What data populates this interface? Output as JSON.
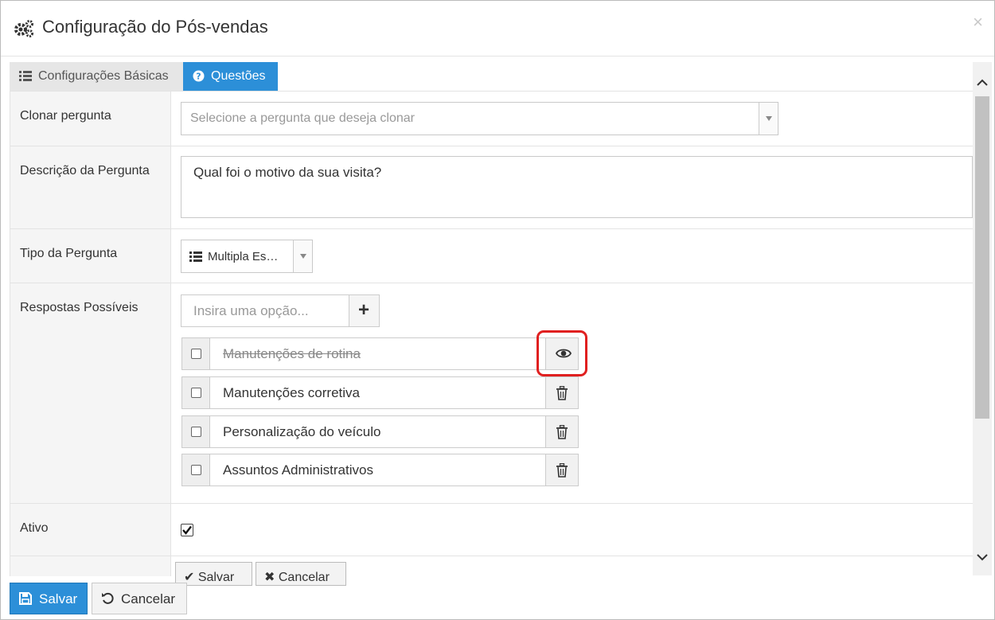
{
  "dialog": {
    "title": "Configuração do Pós-vendas",
    "close_symbol": "×",
    "header_icon": "gears-icon"
  },
  "tabs": [
    {
      "label": "Configurações Básicas",
      "icon": "list-icon",
      "active": false
    },
    {
      "label": "Questões",
      "icon": "question-circle-icon",
      "active": true
    }
  ],
  "form": {
    "clone": {
      "label": "Clonar pergunta",
      "placeholder": "Selecione a pergunta que deseja clonar"
    },
    "description": {
      "label": "Descrição da Pergunta",
      "value": "Qual foi o motivo da sua visita?"
    },
    "type": {
      "label": "Tipo da Pergunta",
      "value": "Multipla Es…",
      "icon": "list-icon"
    },
    "answers": {
      "label": "Respostas Possíveis",
      "input_placeholder": "Insira uma opção...",
      "add_icon": "plus-icon",
      "items": [
        {
          "text": "Manutenções de rotina",
          "struck": true,
          "action_icon": "eye-icon"
        },
        {
          "text": "Manutenções corretiva",
          "struck": false,
          "action_icon": "trash-icon"
        },
        {
          "text": "Personalização do veículo",
          "struck": false,
          "action_icon": "trash-icon"
        },
        {
          "text": "Assuntos Administrativos",
          "struck": false,
          "action_icon": "trash-icon"
        }
      ]
    },
    "active": {
      "label": "Ativo",
      "checked": true
    },
    "inner_buttons": {
      "save_label": "Salvar",
      "cancel_label": "Cancelar"
    }
  },
  "footer": {
    "save_label": "Salvar",
    "cancel_label": "Cancelar"
  },
  "colors": {
    "primary": "#2c8fd8",
    "highlight": "#e02020"
  }
}
